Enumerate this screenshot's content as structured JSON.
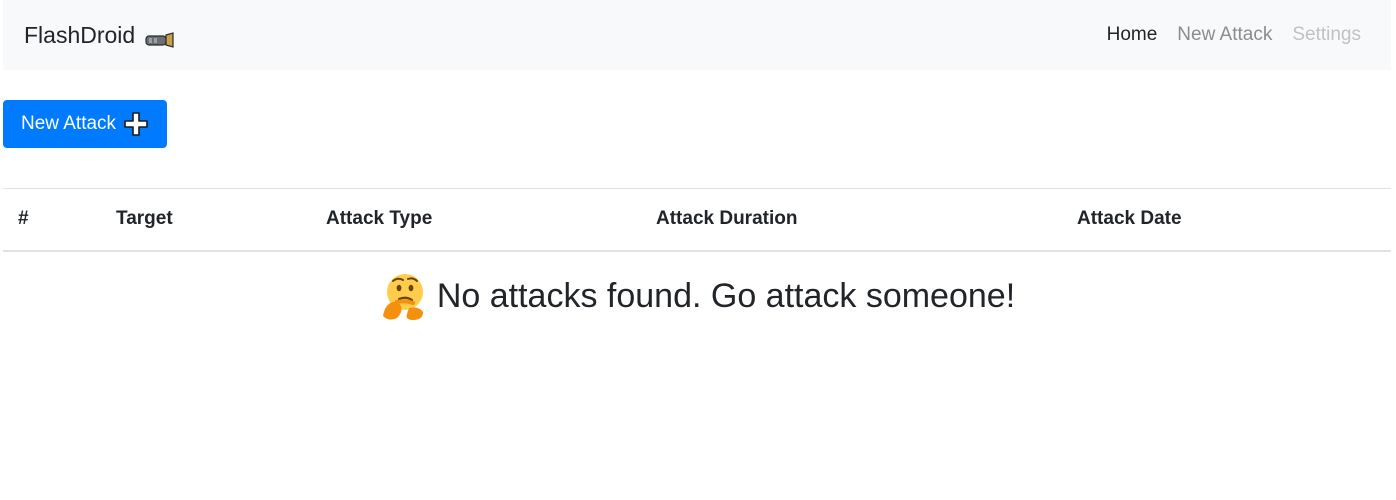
{
  "navbar": {
    "brand": "FlashDroid",
    "brand_icon": "flashlight-icon",
    "links": [
      {
        "label": "Home",
        "state": "active"
      },
      {
        "label": "New Attack",
        "state": "normal"
      },
      {
        "label": "Settings",
        "state": "disabled"
      }
    ]
  },
  "actions": {
    "new_attack_label": "New Attack",
    "new_attack_icon": "plus-icon"
  },
  "table": {
    "headers": [
      "#",
      "Target",
      "Attack Type",
      "Attack Duration",
      "Attack Date"
    ],
    "rows": []
  },
  "empty_state": {
    "icon": "thinking-face-icon",
    "message": "No attacks found. Go attack someone!"
  },
  "colors": {
    "primary": "#007bff",
    "navbar_bg": "#f8f9fa",
    "text": "#212529"
  }
}
